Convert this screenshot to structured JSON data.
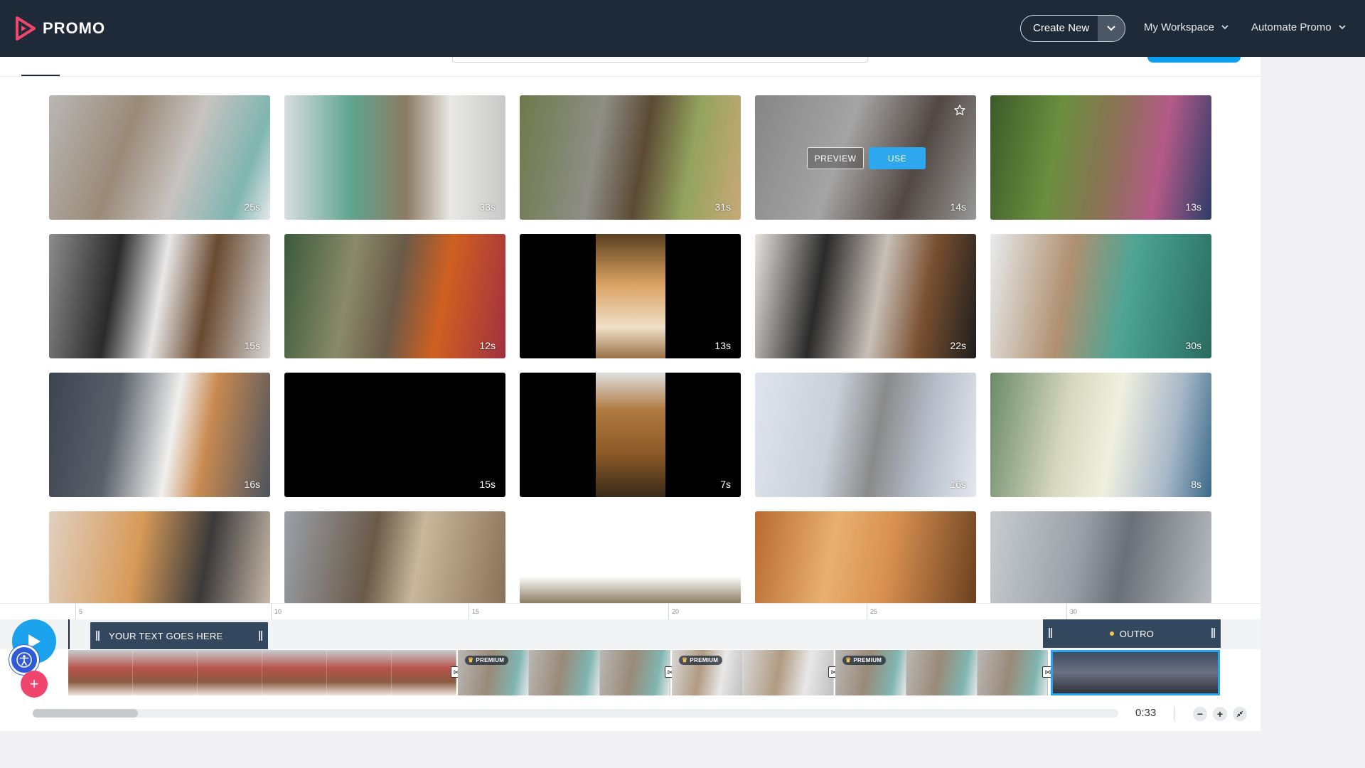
{
  "brand": {
    "name": "PROMO",
    "mark_color": "#f0456d"
  },
  "nav": {
    "create_new": "Create New",
    "my_workspace": "My Workspace",
    "automate_promo": "Automate Promo"
  },
  "tiles": [
    {
      "duration": "25s",
      "bg": "linear-gradient(110deg,#b9b7b4 0%,#9a8a78 35%,#c7c3c0 60%,#7fb5b0 85%,#e6e8ea 100%)"
    },
    {
      "duration": "33s",
      "bg": "linear-gradient(90deg,#d9dde0 0%,#5fa58f 30%,#8c7a62 55%,#e8e8e6 75%,#c9c9c9 100%)"
    },
    {
      "duration": "31s",
      "bg": "linear-gradient(100deg,#6d7a4a 0%,#8e8e86 35%,#5c4a35 55%,#93a35d 75%,#c9a878 100%)"
    },
    {
      "duration": "14s",
      "bg": "linear-gradient(110deg,#b8b8b8 0%,#e7e7e7 40%,#6a5a52 70%,#d3d3d3 100%)",
      "hover": true,
      "preview": "PREVIEW",
      "use": "USE"
    },
    {
      "duration": "13s",
      "bg": "linear-gradient(100deg,#3c5a2a 0%,#6a8f3e 30%,#8c7057 55%,#b45a87 75%,#2c3c6a 100%)"
    },
    {
      "duration": "15s",
      "bg": "linear-gradient(100deg,#8c8c8c 0%,#2a2a2a 30%,#e8e8e8 50%,#6a4a30 70%,#d8d8d8 100%)"
    },
    {
      "duration": "12s",
      "bg": "linear-gradient(100deg,#3a5a3a 0%,#8a8a6a 30%,#6a5a48 50%,#d06020 70%,#a03040 100%)"
    },
    {
      "duration": "13s",
      "bg": "#000",
      "pillar": "linear-gradient(180deg,#5a4020 0%,#d9a060 40%,#f0e0c8 75%,#9a7048 100%)"
    },
    {
      "duration": "22s",
      "bg": "linear-gradient(100deg,#e8e4e0 0%,#2a2a2a 30%,#c8c0b8 55%,#7a5030 75%,#1e1e1e 100%)"
    },
    {
      "duration": "30s",
      "bg": "linear-gradient(100deg,#e8ecee 0%,#b09070 35%,#4fa594 60%,#3a8a7a 80%,#2c6a60 100%)"
    },
    {
      "duration": "16s",
      "bg": "linear-gradient(100deg,#3c4450 0%,#5a606a 30%,#f0f0ee 55%,#c88a50 70%,#4c535e 100%)"
    },
    {
      "duration": "15s",
      "bg": "#000"
    },
    {
      "duration": "7s",
      "bg": "#000",
      "pillar": "linear-gradient(180deg,#e0e0e0 0%,#b07a40 30%,#8a5a28 65%,#3a2a18 100%)"
    },
    {
      "duration": "16s",
      "bg": "linear-gradient(100deg,#dfe4ec 0%,#c9cfd9 35%,#8a8a8a 55%,#b4bcc8 75%,#e4e8ee 100%)"
    },
    {
      "duration": "8s",
      "bg": "linear-gradient(100deg,#6a8a6a 0%,#d8d8c0 35%,#f0f0e0 55%,#a8b8c8 80%,#3a6a8a 100%)"
    },
    {
      "duration": "",
      "bg": "linear-gradient(100deg,#e0d0c0 0%,#d89a58 40%,#3a3a3a 70%,#c8b8a8 100%)"
    },
    {
      "duration": "",
      "bg": "linear-gradient(100deg,#9aa0a8 0%,#6a5a48 40%,#c8b89a 60%,#8a7058 100%)"
    },
    {
      "duration": "",
      "bg": "linear-gradient(180deg,#ffffff 0%,#ffffff 70%,#8a7a60 100%)"
    },
    {
      "duration": "",
      "bg": "linear-gradient(100deg,#b86a30 0%,#e8b070 35%,#d89050 60%,#6a4020 100%)"
    },
    {
      "duration": "",
      "bg": "linear-gradient(100deg,#c8ccd0 0%,#9aa0a8 40%,#6a7078 60%,#b8bcc0 100%)"
    }
  ],
  "timeline": {
    "ruler_ticks": [
      "5",
      "10",
      "15",
      "20",
      "25",
      "30"
    ],
    "text_clip": "YOUR TEXT GOES HERE",
    "outro_clip": "OUTRO",
    "premium_label": "PREMIUM",
    "duration": "0:33",
    "colors": {
      "accent": "#1ba2ec",
      "clip_bg": "#33475e",
      "add": "#f0456d"
    }
  }
}
